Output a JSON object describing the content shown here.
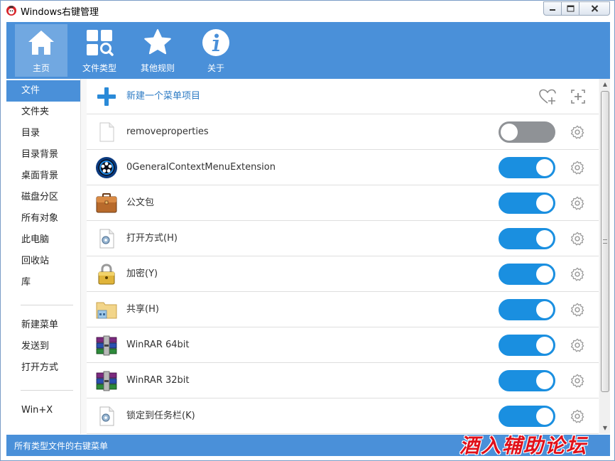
{
  "window": {
    "title": "Windows右键管理"
  },
  "toolbar": {
    "items": [
      {
        "label": "主页",
        "icon": "home-icon",
        "active": true
      },
      {
        "label": "文件类型",
        "icon": "filetype-search-icon"
      },
      {
        "label": "其他规则",
        "icon": "star-icon"
      },
      {
        "label": "关于",
        "icon": "info-icon"
      }
    ]
  },
  "sidebar": {
    "items": [
      {
        "label": "文件",
        "active": true
      },
      {
        "label": "文件夹"
      },
      {
        "label": "目录"
      },
      {
        "label": "目录背景"
      },
      {
        "label": "桌面背景"
      },
      {
        "label": "磁盘分区"
      },
      {
        "label": "所有对象"
      },
      {
        "label": "此电脑"
      },
      {
        "label": "回收站"
      },
      {
        "label": "库"
      },
      {
        "label": "新建菜单"
      },
      {
        "label": "发送到"
      },
      {
        "label": "打开方式"
      },
      {
        "label": "Win+X"
      }
    ]
  },
  "content": {
    "new_item_label": "新建一个菜单项目",
    "items": [
      {
        "label": "removeproperties",
        "icon": "blank-file-icon",
        "enabled": false
      },
      {
        "label": "0GeneralContextMenuExtension",
        "icon": "media-player-icon",
        "enabled": true
      },
      {
        "label": "公文包",
        "icon": "briefcase-icon",
        "enabled": true
      },
      {
        "label": "打开方式(H)",
        "icon": "settings-file-icon",
        "enabled": true
      },
      {
        "label": "加密(Y)",
        "icon": "padlock-icon",
        "enabled": true
      },
      {
        "label": "共享(H)",
        "icon": "share-folder-icon",
        "enabled": true
      },
      {
        "label": "WinRAR 64bit",
        "icon": "winrar-icon",
        "enabled": true
      },
      {
        "label": "WinRAR 32bit",
        "icon": "winrar-icon",
        "enabled": true
      },
      {
        "label": "锁定到任务栏(K)",
        "icon": "settings-file-icon",
        "enabled": true
      }
    ]
  },
  "statusbar": {
    "text": "所有类型文件的右键菜单",
    "watermark": "酒入辅助论坛"
  },
  "colors": {
    "accent": "#4a90d9",
    "toggle_on": "#1a8fe0",
    "toggle_off": "#8f9296"
  }
}
